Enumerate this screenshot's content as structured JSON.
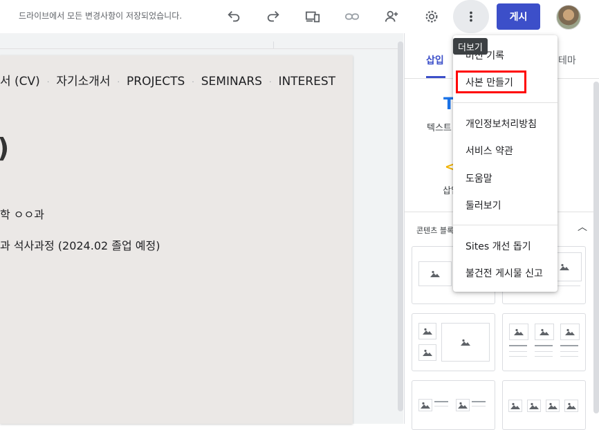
{
  "toolbar": {
    "save_status": "드라이브에서 모든 변경사항이 저장되었습니다.",
    "publish_label": "게시",
    "icons": [
      "undo-icon",
      "redo-icon",
      "preview-icon",
      "link-icon",
      "share-icon",
      "settings-icon",
      "more-vert-icon"
    ]
  },
  "page": {
    "nav": [
      "서 (CV)",
      "자기소개서",
      "PROJECTS",
      "SEMINARS",
      "INTEREST"
    ],
    "nav_separator": "·",
    "heading_fragment": ")",
    "line1": "학 ㅇㅇ과",
    "line2": "과 석사과정 (2024.02 졸업 예정)"
  },
  "panel": {
    "tab_insert": "삽입",
    "tab_theme": "테마",
    "text_icon": "T",
    "text_label": "텍스트",
    "embed_icon": "<",
    "embed_label": "삽입",
    "blocks_label": "콘텐츠 블록"
  },
  "menu": {
    "tooltip": "더보기",
    "items": [
      "버전 기록",
      "사본 만들기",
      "개인정보처리방침",
      "서비스 약관",
      "도움말",
      "둘러보기",
      "Sites 개선 돕기",
      "불건전 게시물 신고"
    ],
    "highlight_color": "#ff0000"
  },
  "colors": {
    "accent": "#3c4fc9",
    "highlight": "#ff0000"
  }
}
